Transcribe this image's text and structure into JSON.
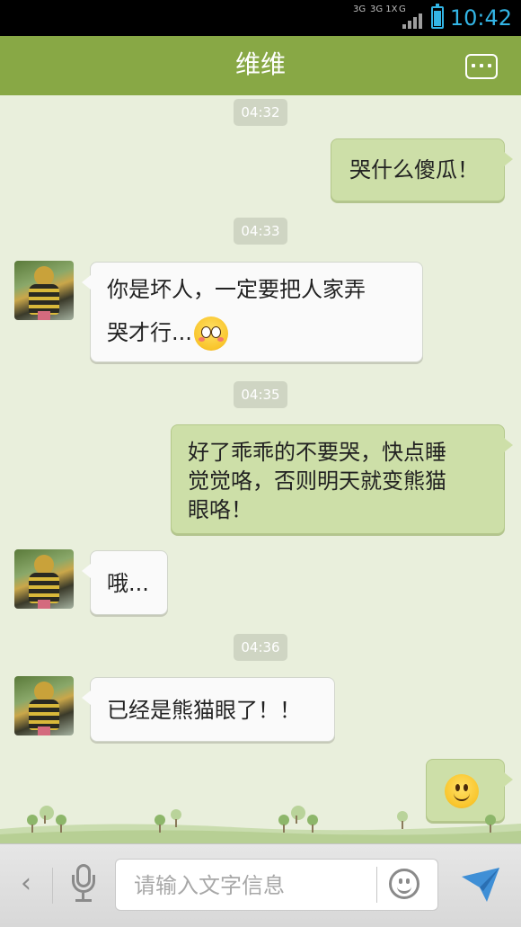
{
  "status_bar": {
    "network_left": "3G",
    "network_mid": "3G 1X",
    "network_right": "G",
    "time": "10:42"
  },
  "header": {
    "title": "维维",
    "more_icon": "more-options-icon"
  },
  "messages": [
    {
      "type": "timestamp",
      "text": "04:32"
    },
    {
      "type": "message",
      "direction": "out",
      "text": "哭什么傻瓜！"
    },
    {
      "type": "timestamp",
      "text": "04:33"
    },
    {
      "type": "message",
      "direction": "in",
      "line1": "你是坏人，一定要把人家弄",
      "line2": "哭才行...",
      "emoji": "shy-face-emoji"
    },
    {
      "type": "timestamp",
      "text": "04:35"
    },
    {
      "type": "message",
      "direction": "out",
      "line1": "好了乖乖的不要哭，快点睡",
      "line2": "觉觉咯，否则明天就变熊猫",
      "line3": "眼咯！"
    },
    {
      "type": "message",
      "direction": "in",
      "text": "哦..."
    },
    {
      "type": "timestamp",
      "text": "04:36"
    },
    {
      "type": "message",
      "direction": "in",
      "text": "已经是熊猫眼了！！"
    },
    {
      "type": "message",
      "direction": "out",
      "emoji": "smile-face-emoji"
    }
  ],
  "input_bar": {
    "placeholder": "请输入文字信息",
    "icons": [
      "back-chevron-icon",
      "microphone-icon",
      "emoji-icon",
      "send-icon"
    ]
  },
  "colors": {
    "header": "#88a845",
    "chat_background": "#e9efdc",
    "outgoing_bubble": "#cddfa8",
    "incoming_bubble": "#fafafa",
    "timestamp_bg": "#cfd5c3",
    "status_time": "#33b5e5",
    "send_icon": "#3f8fd6"
  }
}
